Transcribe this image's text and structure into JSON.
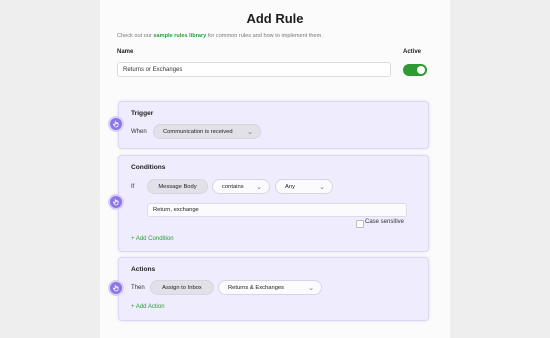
{
  "header": {
    "title": "Add Rule",
    "subtitle_prefix": "Check out our",
    "subtitle_link": "sample rules library",
    "subtitle_suffix": "for common rules and how to implement them."
  },
  "name_field": {
    "label": "Name",
    "value": "Returns or Exchanges"
  },
  "active": {
    "label": "Active",
    "on": true
  },
  "trigger": {
    "title": "Trigger",
    "when_label": "When",
    "event": "Communication is received"
  },
  "conditions": {
    "title": "Conditions",
    "if_label": "If",
    "field": "Message Body",
    "operator": "contains",
    "quantifier": "Any",
    "value": "Return, exchange",
    "case_sensitive_label": "Case sensitive",
    "add_label": "+ Add Condition"
  },
  "actions": {
    "title": "Actions",
    "then_label": "Then",
    "action": "Assign to Inbox",
    "target": "Returns & Exchanges",
    "add_label": "+ Add Action"
  },
  "colors": {
    "accent": "#2e9b32",
    "card_bg": "#efecfd",
    "step_icon": "#8c76e6"
  },
  "icons": {
    "step": "hand-pointer-icon",
    "dropdown": "chevron-down-icon"
  }
}
